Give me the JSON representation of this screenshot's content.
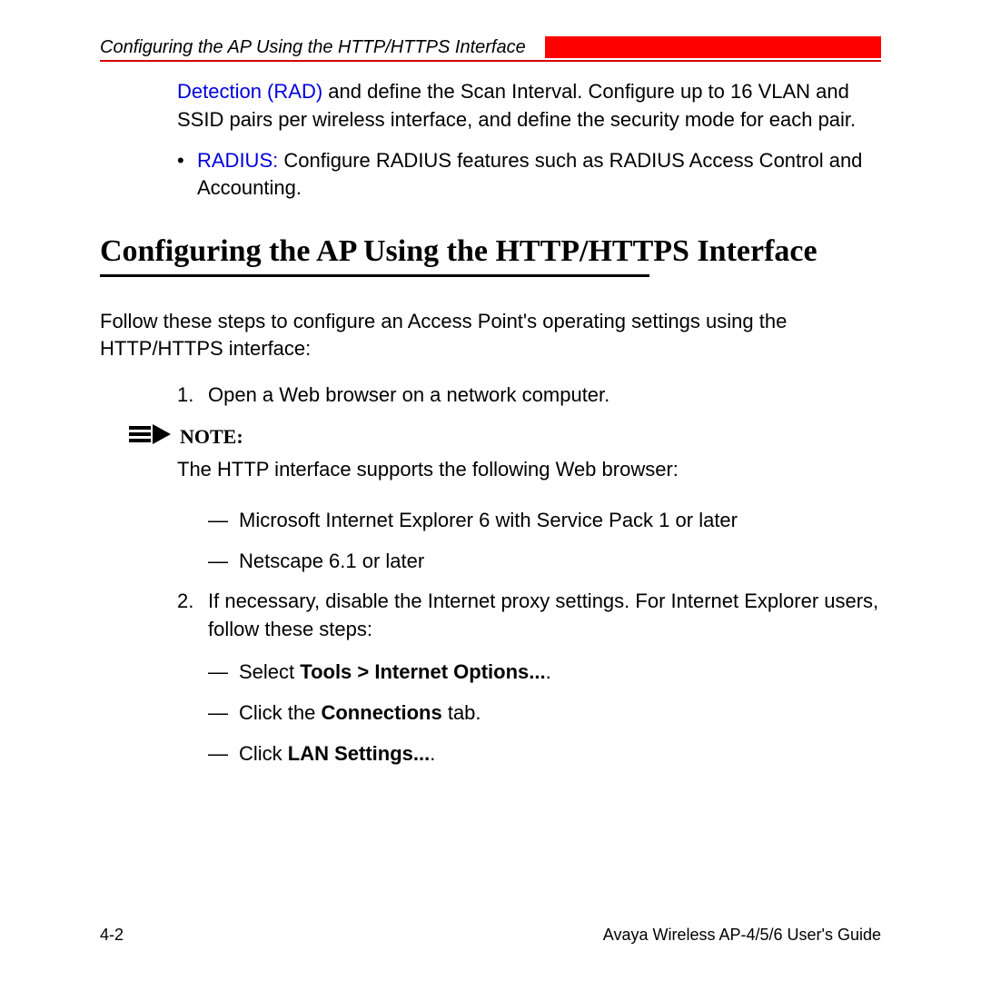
{
  "header": {
    "title": "Configuring the AP Using the HTTP/HTTPS Interface"
  },
  "bullets": {
    "item1": {
      "link": "Detection (RAD)",
      "rest": " and define the Scan Interval. Configure up to 16 VLAN and SSID pairs per wireless interface, and define the security mode for each pair."
    },
    "item2": {
      "link": "RADIUS:",
      "rest": " Configure RADIUS features such as RADIUS Access Control and Accounting."
    }
  },
  "section": {
    "heading": "Configuring the AP Using the HTTP/HTTPS Interface"
  },
  "intro": "Follow these steps to configure an Access Point's operating settings using the HTTP/HTTPS interface:",
  "steps": {
    "s1": {
      "num": "1.",
      "text": "Open a Web browser on a network computer."
    },
    "s2": {
      "num": "2.",
      "text": "If necessary, disable the Internet proxy settings. For Internet Explorer users, follow these steps:"
    }
  },
  "note": {
    "label": "NOTE:",
    "body": "The HTTP interface supports the following Web browser:"
  },
  "browsers": {
    "b1": "Microsoft Internet Explorer 6 with Service Pack 1 or later",
    "b2": "Netscape 6.1 or later"
  },
  "substeps": {
    "a": {
      "pre": "Select ",
      "bold": "Tools > Internet Options...",
      "post": "."
    },
    "b": {
      "pre": "Click the ",
      "bold": "Connections",
      "post": " tab."
    },
    "c": {
      "pre": "Click ",
      "bold": "LAN Settings...",
      "post": "."
    }
  },
  "footer": {
    "left": "4-2",
    "right": "Avaya Wireless AP-4/5/6 User's Guide"
  }
}
